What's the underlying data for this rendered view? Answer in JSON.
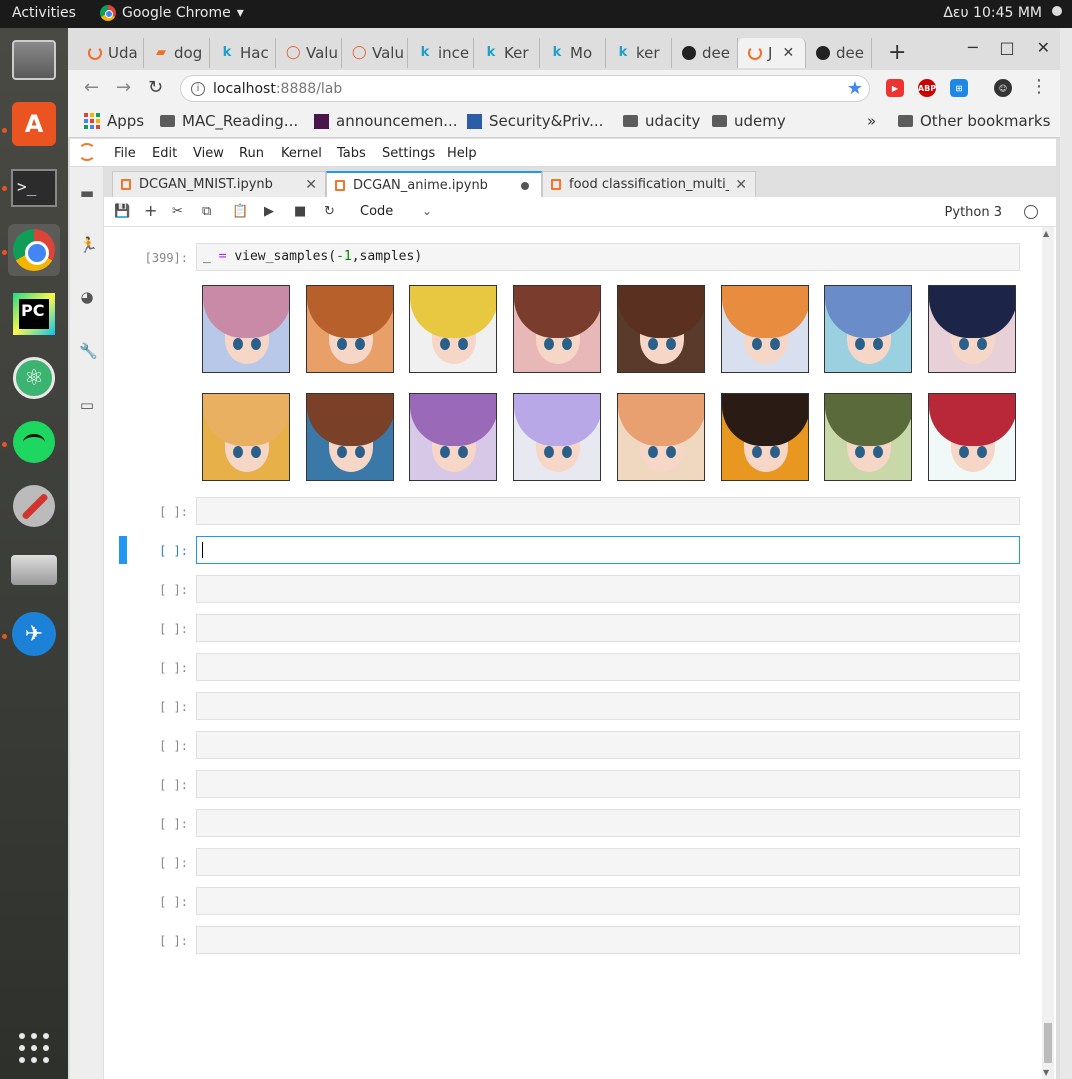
{
  "topbar": {
    "activities": "Activities",
    "app_name": "Google Chrome",
    "clock": "Δευ 10:45 ΜΜ"
  },
  "dock": {
    "items": [
      "files-icon",
      "software-icon",
      "terminal-icon",
      "chrome-icon",
      "pycharm-icon",
      "atom-icon",
      "spotify-icon",
      "tools-icon",
      "disk-icon",
      "office-icon",
      "apps-grid-icon"
    ]
  },
  "browser": {
    "tabs": [
      {
        "label": "Uda",
        "icon": "udacity"
      },
      {
        "label": "dog",
        "icon": "doc"
      },
      {
        "label": "Hac",
        "icon": "k"
      },
      {
        "label": "Valu",
        "icon": "drop"
      },
      {
        "label": "Valu",
        "icon": "drop"
      },
      {
        "label": "ince",
        "icon": "k"
      },
      {
        "label": "Ker",
        "icon": "k"
      },
      {
        "label": "Mo",
        "icon": "k"
      },
      {
        "label": "ker",
        "icon": "k"
      },
      {
        "label": "dee",
        "icon": "github"
      },
      {
        "label": "J",
        "icon": "jupyter"
      },
      {
        "label": "dee",
        "icon": "github"
      }
    ],
    "url_host": "localhost",
    "url_path": ":8888/lab",
    "ext_abp": "ABP",
    "bookmarks": {
      "apps": "Apps",
      "items": [
        "MAC_Reading...",
        "announcemen...",
        "Security&Priv...",
        "udacity",
        "udemy"
      ],
      "more": "»",
      "other": "Other bookmarks"
    }
  },
  "jupyter": {
    "menu": [
      "File",
      "Edit",
      "View",
      "Run",
      "Kernel",
      "Tabs",
      "Settings",
      "Help"
    ],
    "doc_tabs": [
      "DCGAN_MNIST.ipynb",
      "DCGAN_anime.ipynb",
      "food classification_multi_crop"
    ],
    "cell_type": "Code",
    "kernel": "Python 3",
    "output_cell": {
      "prompt": "[399]:",
      "code_var": "_",
      "code_eq": " = ",
      "code_call": "view_samples(",
      "code_num": "-1",
      "code_tail": ",samples)"
    },
    "empty_prompt": "[ ]:",
    "empty_cells_count_label": "12"
  },
  "colors": {
    "jupyter_accent": "#2196f3",
    "jupyter_orange": "#f37726",
    "ubuntu_orange": "#e95420"
  }
}
